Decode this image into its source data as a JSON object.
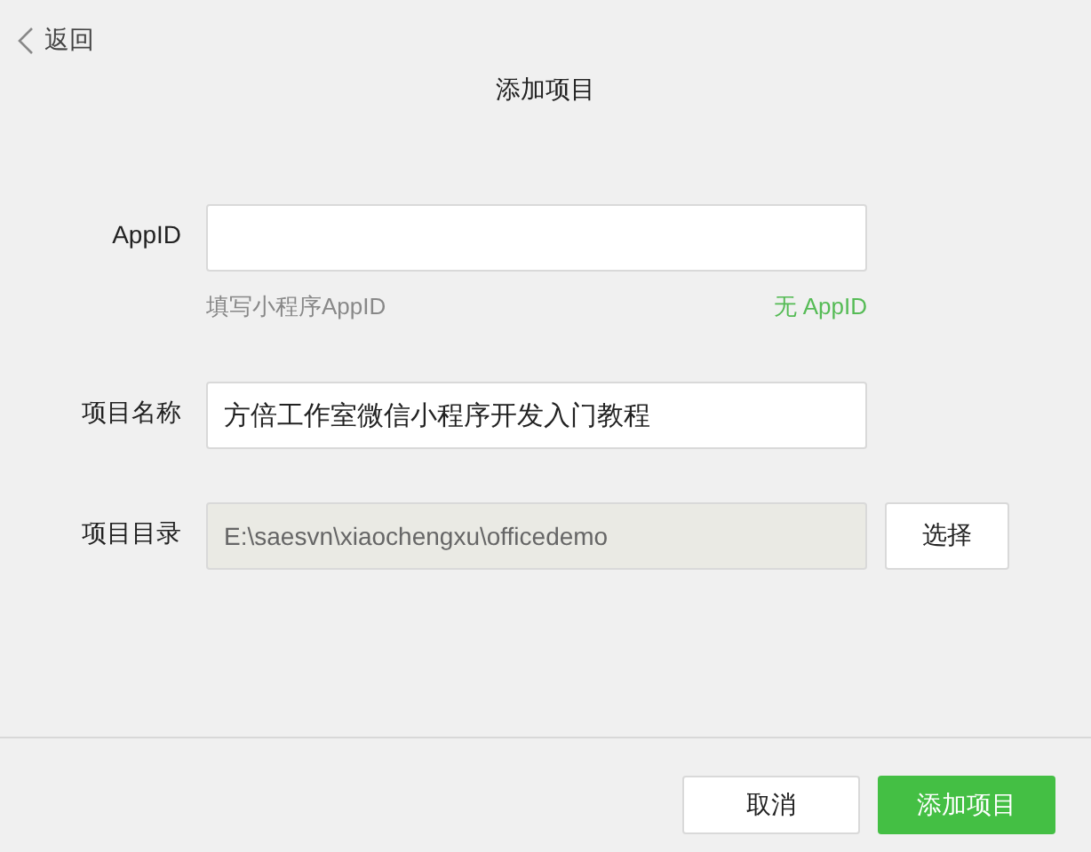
{
  "back": {
    "label": "返回"
  },
  "title": "添加项目",
  "fields": [
    {
      "label": "AppID",
      "disabled": false,
      "hint": "填写小程序AppID",
      "link": "无 AppID"
    },
    {
      "label": "项目名称",
      "value": "方倍工作室微信小程序开发入门教程",
      "disabled": false
    },
    {
      "label": "项目目录",
      "value": "E:\\saesvn\\xiaochengxu\\officedemo",
      "disabled": true,
      "button": "选择"
    }
  ],
  "buttons": [
    {
      "label": "取消",
      "kind": "secondary"
    },
    {
      "label": "添加项目",
      "kind": "primary"
    }
  ]
}
